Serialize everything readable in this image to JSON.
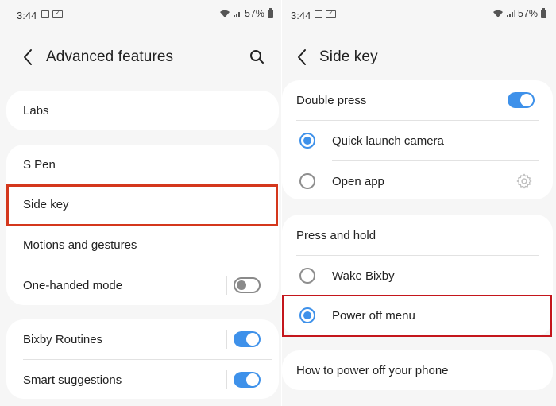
{
  "left": {
    "status": {
      "time": "3:44",
      "battery": "57%"
    },
    "header": {
      "title": "Advanced features"
    },
    "items": {
      "labs": "Labs",
      "s_pen": "S Pen",
      "side_key": "Side key",
      "motions": "Motions and gestures",
      "one_handed": "One-handed mode",
      "bixby_routines": "Bixby Routines",
      "smart_suggestions": "Smart suggestions"
    },
    "toggles": {
      "one_handed": false,
      "bixby_routines": true,
      "smart_suggestions": true
    }
  },
  "right": {
    "status": {
      "time": "3:44",
      "battery": "57%"
    },
    "header": {
      "title": "Side key"
    },
    "double_press": {
      "label": "Double press",
      "enabled": true,
      "options": [
        "Quick launch camera",
        "Open app"
      ],
      "selected": "Quick launch camera"
    },
    "press_and_hold": {
      "label": "Press and hold",
      "options": [
        "Wake Bixby",
        "Power off menu"
      ],
      "selected": "Power off menu"
    },
    "how_to": "How to power off your phone"
  },
  "colors": {
    "accent": "#3e91ea",
    "highlight": "#d4371c",
    "background": "#f6f6f6",
    "card": "#ffffff"
  }
}
